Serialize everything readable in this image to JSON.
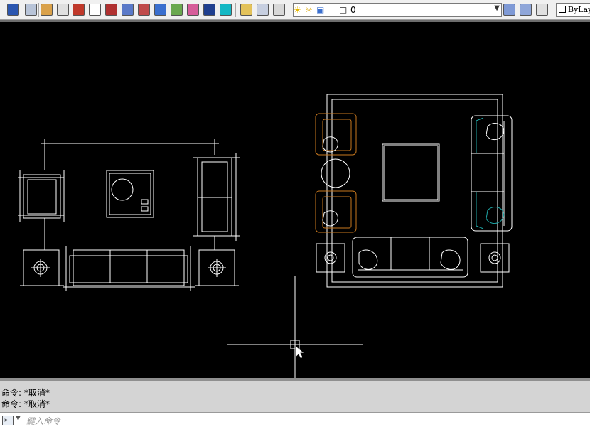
{
  "toolbar": {
    "icons": [
      "save-icon",
      "print-icon",
      "cut-icon",
      "copy-icon",
      "paste-icon",
      "match-properties-icon",
      "block-editor-icon",
      "hatch-icon",
      "table-icon",
      "design-center-icon",
      "tool-palettes-icon",
      "sheet-set-icon",
      "markup-icon",
      "quickcalc-icon",
      "layer-properties-icon",
      "layer-states-icon",
      "layer-previous-icon"
    ],
    "layer_icons": [
      "lightbulb-on-icon",
      "sun-icon",
      "lock-icon",
      "color-swatch-icon"
    ],
    "current_layer": "0",
    "right_icons": [
      "make-current-icon",
      "layer-match-icon",
      "layer-previous-right-icon"
    ],
    "linetype_value": "ByLay"
  },
  "command_line": {
    "history": [
      "命令: *取消*",
      "命令: *取消*"
    ],
    "placeholder": "鍵入命令"
  },
  "colors": {
    "background": "#000000",
    "geometry": "#ffffff",
    "orange_layer": "#c8781e",
    "cyan_layer": "#1fa7a7",
    "crosshair": "#ffffff"
  }
}
